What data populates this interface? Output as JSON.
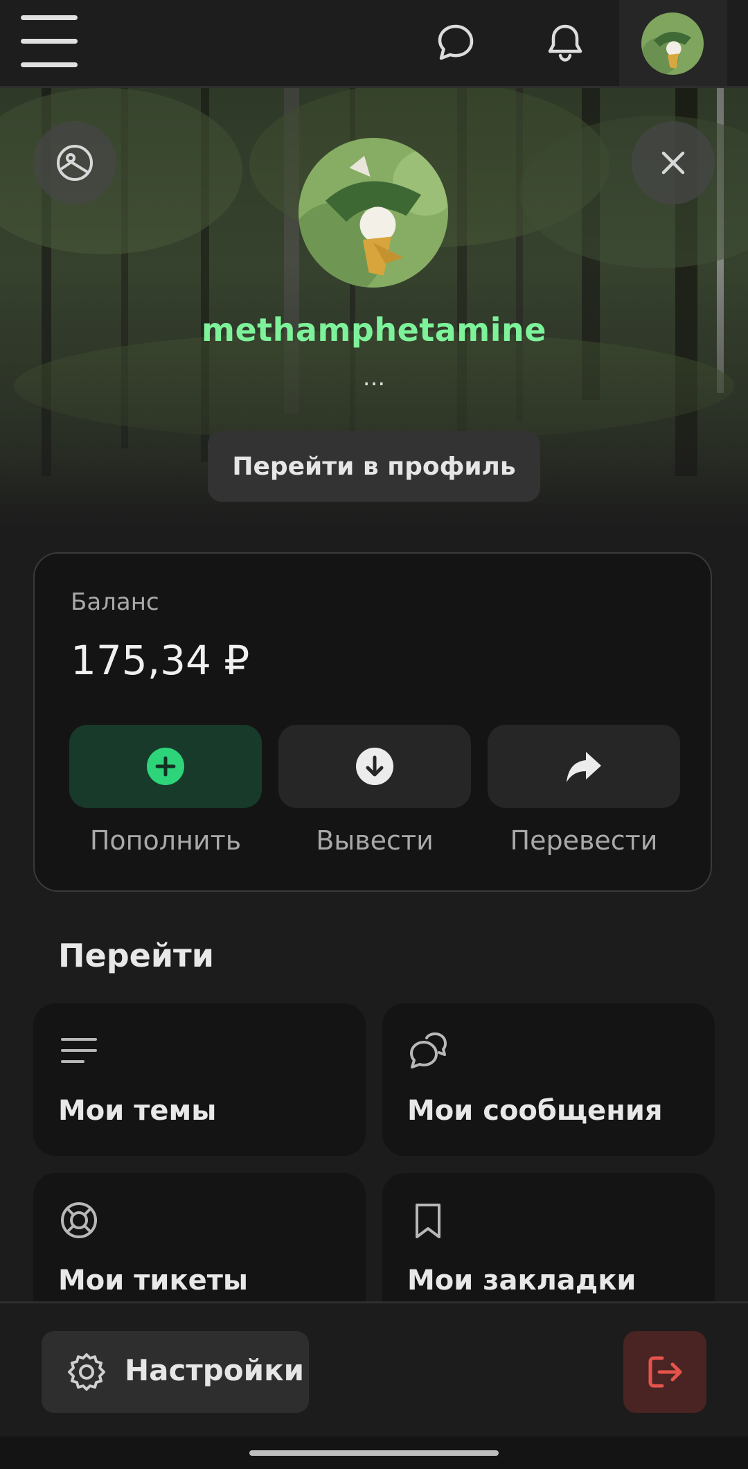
{
  "header": {
    "menu_icon": "hamburger-icon",
    "chat_icon": "chat-bubble-icon",
    "notification_icon": "bell-icon"
  },
  "profile": {
    "username": "methamphetamine",
    "status": "...",
    "go_to_profile": "Перейти в профиль",
    "username_color": "#7df29a"
  },
  "balance": {
    "label": "Баланс",
    "value": "175,34 ₽",
    "actions": [
      {
        "label": "Пополнить",
        "icon": "plus-circle-icon"
      },
      {
        "label": "Вывести",
        "icon": "arrow-down-circle-icon"
      },
      {
        "label": "Перевести",
        "icon": "share-arrow-icon"
      }
    ]
  },
  "navigate": {
    "title": "Перейти",
    "items": [
      {
        "label": "Мои темы",
        "icon": "lines-icon"
      },
      {
        "label": "Мои сообщения",
        "icon": "chat-bubbles-icon"
      },
      {
        "label": "Мои тикеты",
        "icon": "lifebuoy-icon"
      },
      {
        "label": "Мои закладки",
        "icon": "bookmark-icon"
      }
    ]
  },
  "footer": {
    "settings_label": "Настройки",
    "logout_icon": "logout-icon"
  },
  "colors": {
    "background": "#1c1c1c",
    "card": "#141414",
    "accent_green": "#2ed47a",
    "danger": "#e5534b"
  }
}
